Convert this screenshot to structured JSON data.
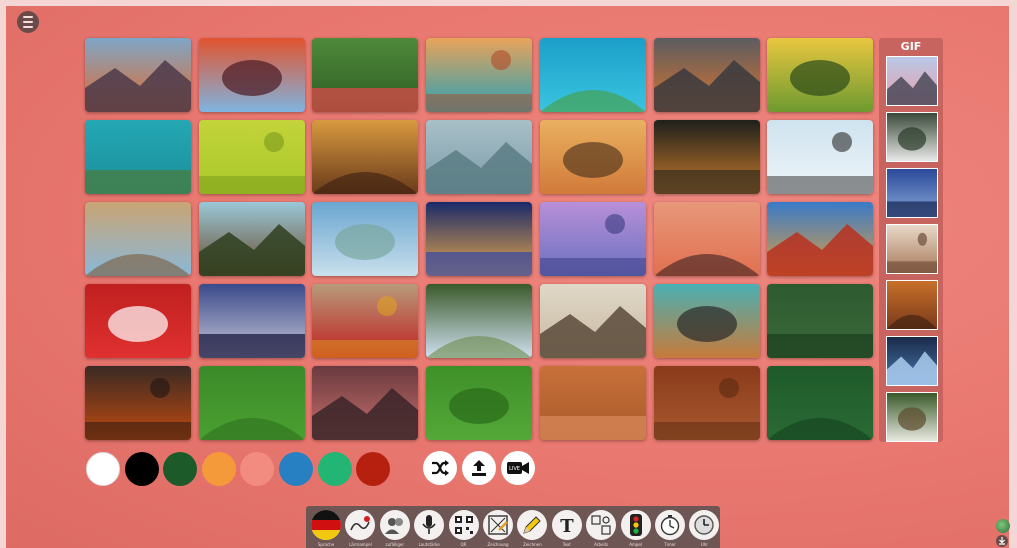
{
  "menu": {
    "icon": "hamburger-icon"
  },
  "wallpapers": [
    {
      "name": "yosemite-el-capitan",
      "colors": [
        "#7fa6c7",
        "#e06a2c",
        "#4c3a4a"
      ]
    },
    {
      "name": "antelope-canyon",
      "colors": [
        "#e2532e",
        "#7fb4e0",
        "#4a1a22"
      ]
    },
    {
      "name": "flower-meadow",
      "colors": [
        "#4f8a3a",
        "#2d5c24",
        "#d94a4a"
      ]
    },
    {
      "name": "horseshoe-bend",
      "colors": [
        "#e9a35a",
        "#2aa0b4",
        "#b24a26"
      ]
    },
    {
      "name": "island-aerial",
      "colors": [
        "#1b9fc9",
        "#3ac4e0",
        "#4a9c3a"
      ]
    },
    {
      "name": "uluru",
      "colors": [
        "#5c5c62",
        "#d8752d",
        "#3a3a3e"
      ]
    },
    {
      "name": "sunny-forest-meadow",
      "colors": [
        "#e8c640",
        "#6e9a30",
        "#2b4a18"
      ]
    },
    {
      "name": "sea-turtle",
      "colors": [
        "#24a8b4",
        "#1a8e9a",
        "#4a7c40"
      ]
    },
    {
      "name": "green-grapes",
      "colors": [
        "#c3d43a",
        "#a8c82a",
        "#7a9a1a"
      ]
    },
    {
      "name": "foggy-forest-sunrise",
      "colors": [
        "#d89a40",
        "#6a3a1a",
        "#3a1f10"
      ]
    },
    {
      "name": "misty-birds",
      "colors": [
        "#a8c0c8",
        "#7a9aa6",
        "#5a7c84"
      ]
    },
    {
      "name": "safari-elephants",
      "colors": [
        "#e9b060",
        "#d27a3a",
        "#5a3a20"
      ]
    },
    {
      "name": "fox-dark",
      "colors": [
        "#1e201c",
        "#c87a2a",
        "#3a3020"
      ]
    },
    {
      "name": "penguins-ice",
      "colors": [
        "#cfe3ef",
        "#eef4f8",
        "#2a2a2a"
      ]
    },
    {
      "name": "colosseum",
      "colors": [
        "#c9a474",
        "#8ab8d8",
        "#7a5a3a"
      ]
    },
    {
      "name": "eiffel-tower",
      "colors": [
        "#9ac8d8",
        "#6a4a2a",
        "#2f3f20"
      ]
    },
    {
      "name": "statue-of-liberty",
      "colors": [
        "#6aa6d0",
        "#c9e0ec",
        "#7aa6a0"
      ]
    },
    {
      "name": "brandenburg-gate",
      "colors": [
        "#1a2a6a",
        "#e8a84a",
        "#3a4aa0"
      ]
    },
    {
      "name": "taj-mahal",
      "colors": [
        "#b890d8",
        "#6a70c0",
        "#3a3a80"
      ]
    },
    {
      "name": "pagoda-sunset",
      "colors": [
        "#e8987a",
        "#e07050",
        "#3a2020"
      ]
    },
    {
      "name": "golden-gate",
      "colors": [
        "#3a7ac8",
        "#e0a040",
        "#b83020"
      ]
    },
    {
      "name": "running-track",
      "colors": [
        "#c02020",
        "#e03030",
        "#ffffff"
      ]
    },
    {
      "name": "subway-blue",
      "colors": [
        "#3a4a8a",
        "#c8c8d8",
        "#1a1a40"
      ]
    },
    {
      "name": "board-game-pawns",
      "colors": [
        "#b89a7a",
        "#c02020",
        "#e0a020"
      ]
    },
    {
      "name": "open-book",
      "colors": [
        "#3a5a2a",
        "#d0e0f0",
        "#6a8a4a"
      ]
    },
    {
      "name": "guitar-neck",
      "colors": [
        "#e0d8c8",
        "#c8b8a0",
        "#5a4a3a"
      ]
    },
    {
      "name": "colored-pencils",
      "colors": [
        "#4ab0b4",
        "#c87a3a",
        "#2a2a2a"
      ]
    },
    {
      "name": "chalkboard-green",
      "colors": [
        "#2e5a30",
        "#3a6a3a",
        "#1e4020"
      ]
    },
    {
      "name": "fire-embers",
      "colors": [
        "#3a2a24",
        "#c04a10",
        "#1e1612"
      ]
    },
    {
      "name": "soccer-field",
      "colors": [
        "#3c8a2a",
        "#4aa030",
        "#2e7020"
      ]
    },
    {
      "name": "gradient-dusk",
      "colors": [
        "#6a3a40",
        "#c8706a",
        "#3a2428"
      ]
    },
    {
      "name": "grass-field",
      "colors": [
        "#3e9028",
        "#54a838",
        "#2a6a1a"
      ]
    },
    {
      "name": "wood-light",
      "colors": [
        "#c8703a",
        "#a85a2a",
        "#d8885a"
      ]
    },
    {
      "name": "wood-brick",
      "colors": [
        "#8a3a1a",
        "#a85a30",
        "#5a2a10"
      ]
    },
    {
      "name": "chalkboard-dark-green",
      "colors": [
        "#1e5a2a",
        "#2a6a34",
        "#14401e"
      ]
    }
  ],
  "gif_panel": {
    "title": "GIF",
    "items": [
      {
        "name": "lighthouse",
        "colors": [
          "#b8c8e8",
          "#e8a0a8",
          "#4a4a5a"
        ]
      },
      {
        "name": "forest-path",
        "colors": [
          "#3a4a3a",
          "#e8e8e8",
          "#2a3a2a"
        ]
      },
      {
        "name": "night-beach",
        "colors": [
          "#2a4a9a",
          "#8aa8d8",
          "#1a2a5a"
        ]
      },
      {
        "name": "rocky-coast",
        "colors": [
          "#e8d8c8",
          "#a87a5a",
          "#5a3a2a"
        ]
      },
      {
        "name": "city-night",
        "colors": [
          "#c8702a",
          "#7a3a1a",
          "#3a2010"
        ]
      },
      {
        "name": "bridge-night",
        "colors": [
          "#1a2a4a",
          "#4a7ab0",
          "#aaccee"
        ]
      },
      {
        "name": "waterfall",
        "colors": [
          "#3a5a2a",
          "#e8e8e0",
          "#5a4a2a"
        ]
      }
    ]
  },
  "colors": [
    "#ffffff",
    "#000000",
    "#1d5a2a",
    "#f59a3a",
    "#f28b80",
    "#2680c2",
    "#22b573",
    "#b5210e"
  ],
  "actions": [
    {
      "name": "shuffle-button",
      "icon": "shuffle-icon"
    },
    {
      "name": "upload-button",
      "icon": "upload-icon"
    },
    {
      "name": "live-video-button",
      "icon": "live-camera-icon",
      "text": "LIVE"
    }
  ],
  "toolbar": [
    {
      "name": "language",
      "label": "Sprache",
      "icon": "german-flag-icon"
    },
    {
      "name": "noise-meter",
      "label": "Lärmampel",
      "icon": "noise-meter-icon"
    },
    {
      "name": "random-name",
      "label": "zufälliger",
      "icon": "random-name-icon"
    },
    {
      "name": "sound-level",
      "label": "Lautstärke",
      "icon": "microphone-icon"
    },
    {
      "name": "qr-code",
      "label": "QR",
      "icon": "qr-code-icon"
    },
    {
      "name": "drawing",
      "label": "Zeichnung",
      "icon": "drawing-icon"
    },
    {
      "name": "draw-board",
      "label": "Zeichnen",
      "icon": "pencil-icon"
    },
    {
      "name": "text",
      "label": "Text",
      "icon": "text-icon",
      "glyph": "T"
    },
    {
      "name": "work-symbols",
      "label": "Arbeits",
      "icon": "work-symbols-icon"
    },
    {
      "name": "traffic-light",
      "label": "Ampel",
      "icon": "traffic-light-icon"
    },
    {
      "name": "timer",
      "label": "Timer",
      "icon": "timer-icon"
    },
    {
      "name": "clock",
      "label": "Uhr",
      "icon": "clock-icon"
    }
  ]
}
